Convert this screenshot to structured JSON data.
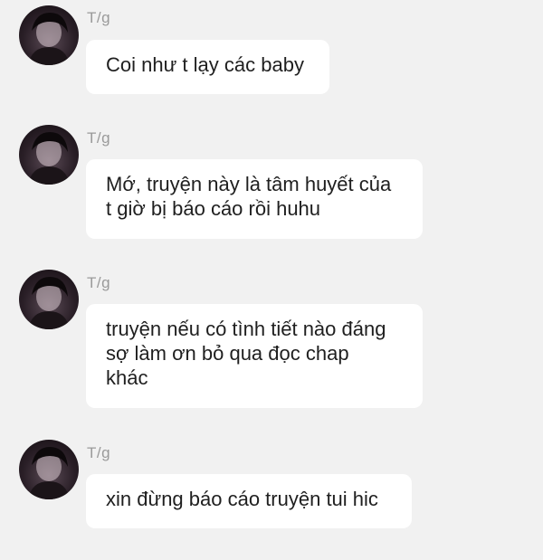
{
  "messages": [
    {
      "sender": "T/g",
      "lines": [
        "Coi như t lạy các baby"
      ]
    },
    {
      "sender": "T/g",
      "lines": [
        "Mớ, truyện này là tâm huyết của",
        "t giờ bị báo cáo rồi huhu"
      ]
    },
    {
      "sender": "T/g",
      "lines": [
        "truyện nếu có tình tiết nào đáng",
        "sợ làm ơn bỏ qua đọc chap",
        "khác"
      ]
    },
    {
      "sender": "T/g",
      "lines": [
        "xin đừng báo cáo truyện tui hic"
      ]
    }
  ]
}
